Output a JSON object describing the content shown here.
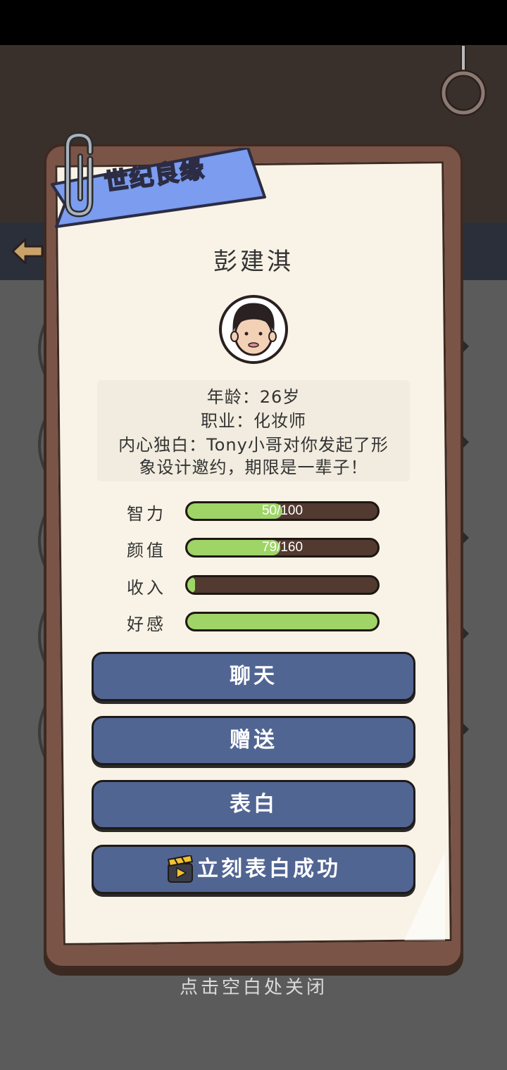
{
  "ribbon": {
    "title": "世纪良缘"
  },
  "profile": {
    "name": "彭建淇",
    "age_line": "年龄：26岁",
    "job_line": "职业：化妆师",
    "monologue_line1": "内心独白：Tony小哥对你发起了形",
    "monologue_line2": "象设计邀约，期限是一辈子！"
  },
  "stats": [
    {
      "label": "智力",
      "value_text": "50/100",
      "fill": 0.5
    },
    {
      "label": "颜值",
      "value_text": "79/160",
      "fill": 0.49
    },
    {
      "label": "收入",
      "value_text": "",
      "fill": 0.04
    },
    {
      "label": "好感",
      "value_text": "",
      "fill": 1.0
    }
  ],
  "actions": {
    "chat": "聊天",
    "gift": "赠送",
    "confess": "表白",
    "instant_confess": "立刻表白成功"
  },
  "close_hint": "点击空白处关闭",
  "colors": {
    "bar_fill": "#9fd467",
    "bar_track": "#523a30",
    "button": "#516593",
    "ribbon": "#7b9cef",
    "board": "#7a5446",
    "paper": "#f8f3e6"
  },
  "icons": [
    "back-arrow-icon",
    "hanging-ring-icon",
    "paperclip-icon",
    "avatar-icon",
    "video-clapper-icon"
  ]
}
